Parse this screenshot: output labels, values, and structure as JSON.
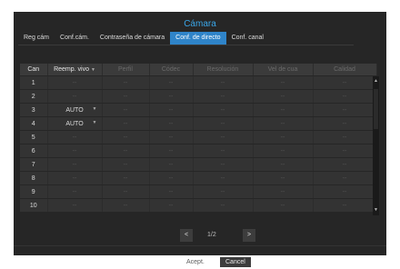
{
  "dialog": {
    "title": "Cámara"
  },
  "tabs": [
    {
      "label": "Reg cám"
    },
    {
      "label": "Conf.cám."
    },
    {
      "label": "Contraseña de cámara"
    },
    {
      "label": "Conf. de directo",
      "active": true
    },
    {
      "label": "Conf. canal"
    }
  ],
  "table": {
    "headers": [
      "Can",
      "Reemp. vivo",
      "Perfil",
      "Códec",
      "Resolución",
      "Vel de cua",
      "Calidad"
    ],
    "rows": [
      {
        "ch": "1",
        "live": "--"
      },
      {
        "ch": "2",
        "live": "--"
      },
      {
        "ch": "3",
        "live": "AUTO"
      },
      {
        "ch": "4",
        "live": "AUTO"
      },
      {
        "ch": "5",
        "live": "--"
      },
      {
        "ch": "6",
        "live": "--"
      },
      {
        "ch": "7",
        "live": "--"
      },
      {
        "ch": "8",
        "live": "--"
      },
      {
        "ch": "9",
        "live": "--"
      },
      {
        "ch": "10",
        "live": "--"
      }
    ],
    "dash": "--"
  },
  "pager": {
    "prev": "<",
    "next": ">",
    "page": "1/2"
  },
  "buttons": {
    "ok": "Acept.",
    "cancel": "Cancel"
  },
  "colors": {
    "accent": "#2f84c9",
    "title": "#3aa6e8",
    "panel": "#262626"
  }
}
